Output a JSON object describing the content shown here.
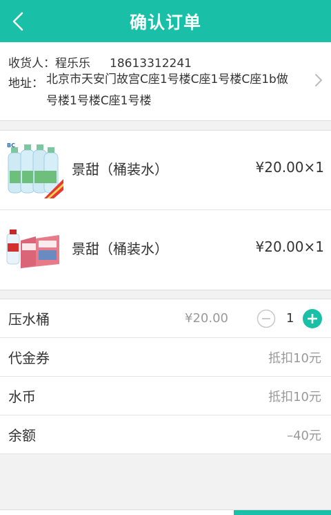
{
  "header": {
    "title": "确认订单",
    "back_icon": "chevron-left-icon"
  },
  "address": {
    "consignee_label": "收货人：",
    "consignee_name": "程乐乐",
    "phone": "18613312241",
    "address_label": "地址：",
    "address_text": "北京市天安门故宫C座1号楼C座1号楼C座1b做号楼1号楼C座1号楼",
    "arrow_icon": "chevron-right-icon"
  },
  "goods": [
    {
      "name": "景甜（桶装水）",
      "price": "¥20.00×1",
      "thumb": "water-bottle-pack-image"
    },
    {
      "name": "景甜（桶装水）",
      "price": "¥20.00×1",
      "thumb": "water-carton-image"
    }
  ],
  "options": {
    "bucket": {
      "label": "压水桶",
      "price": "¥20.00",
      "quantity": "1"
    },
    "voucher": {
      "label": "代金券",
      "value": "抵扣10元"
    },
    "coin": {
      "label": "水币",
      "value": "抵扣10元"
    },
    "balance": {
      "label": "余额",
      "value": "–40元"
    }
  },
  "colors": {
    "accent": "#19bfa6",
    "text": "#333333",
    "muted": "#999999",
    "background": "#f2f2f2"
  }
}
